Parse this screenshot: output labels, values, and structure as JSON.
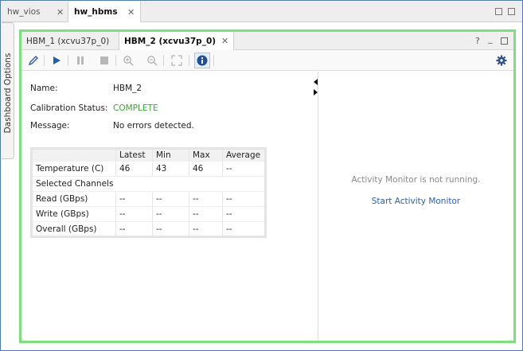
{
  "outer_tabs": [
    {
      "label": "hw_vios",
      "active": false
    },
    {
      "label": "hw_hbms",
      "active": true
    }
  ],
  "side_panel": {
    "label": "Dashboard Options"
  },
  "inner_tabs": [
    {
      "label": "HBM_1 (xcvu37p_0)",
      "active": false
    },
    {
      "label": "HBM_2 (xcvu37p_0)",
      "active": true
    }
  ],
  "inner_controls": {
    "help": "?",
    "minimize": "_"
  },
  "toolbar": {
    "icons": [
      "edit-icon",
      "run-icon",
      "pause-icon",
      "stop-icon",
      "zoom-in-icon",
      "zoom-out-icon",
      "fit-icon",
      "info-icon",
      "gear-icon"
    ]
  },
  "details": {
    "name_label": "Name:",
    "name_value": "HBM_2",
    "calibration_label": "Calibration Status:",
    "calibration_value": "COMPLETE",
    "message_label": "Message:",
    "message_value": "No errors detected."
  },
  "stats_table": {
    "headers": [
      "",
      "Latest",
      "Min",
      "Max",
      "Average"
    ],
    "rows": [
      {
        "label": "Temperature (C)",
        "values": [
          "46",
          "43",
          "46",
          "--"
        ]
      },
      {
        "label": "Selected Channels",
        "values": [
          "",
          "",
          "",
          ""
        ]
      },
      {
        "label": "Read (GBps)",
        "values": [
          "--",
          "--",
          "--",
          "--"
        ]
      },
      {
        "label": "Write (GBps)",
        "values": [
          "--",
          "--",
          "--",
          "--"
        ]
      },
      {
        "label": "Overall (GBps)",
        "values": [
          "--",
          "--",
          "--",
          "--"
        ]
      }
    ]
  },
  "activity_monitor": {
    "message": "Activity Monitor is not running.",
    "link": "Start Activity Monitor"
  },
  "colors": {
    "accent_border": "#7be27b",
    "status_ok": "#3aa63a",
    "link": "#2a5fb8"
  }
}
